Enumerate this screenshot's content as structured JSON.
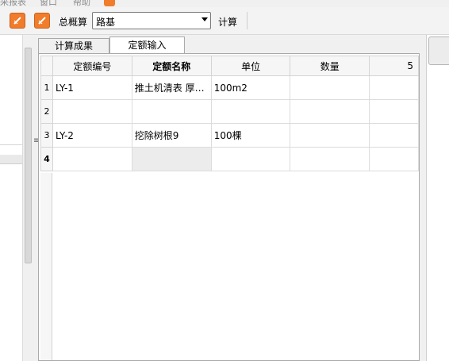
{
  "menu": {
    "items": [
      {
        "label": "采报表"
      },
      {
        "label": "窗口"
      },
      {
        "label": "帮助"
      }
    ]
  },
  "toolbar": {
    "buttons": [
      {
        "icon": "orange-tool-icon-1"
      },
      {
        "icon": "orange-tool-icon-2"
      }
    ],
    "budget_label": "总概算",
    "combo_value": "路基",
    "calc_label": "计算"
  },
  "tabs": [
    {
      "label": "计算成果",
      "active": false
    },
    {
      "label": "定额输入",
      "active": true
    }
  ],
  "grid": {
    "columns": [
      "",
      "定额编号",
      "定额名称",
      "单位",
      "数量",
      "5"
    ],
    "rows": [
      {
        "num": "1",
        "code": "LY-1",
        "name": "推土机清表 厚…",
        "unit": "100m2",
        "qty": "",
        "col5": ""
      },
      {
        "num": "2",
        "code": "",
        "name": "",
        "unit": "",
        "qty": "",
        "col5": ""
      },
      {
        "num": "3",
        "code": "LY-2",
        "name": "挖除树根9",
        "unit": "100棵",
        "qty": "",
        "col5": ""
      },
      {
        "num": "4",
        "code": "",
        "name": "",
        "unit": "",
        "qty": "",
        "col5": ""
      }
    ]
  },
  "colors": {
    "accent": "#f07c2c",
    "toolbar_bg": "#f3f3f3",
    "grid_border": "#dcdcdc"
  }
}
